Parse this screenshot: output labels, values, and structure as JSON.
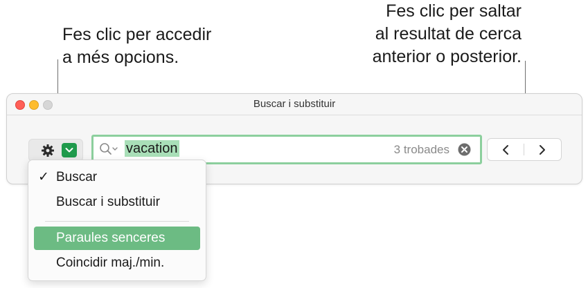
{
  "callouts": {
    "options_line1": "Fes clic per accedir",
    "options_line2": "a més opcions.",
    "nav_line1": "Fes clic per saltar",
    "nav_line2": "al resultat de cerca",
    "nav_line3": "anterior o posterior."
  },
  "window": {
    "title": "Buscar i substituir"
  },
  "search": {
    "query": "vacation",
    "match_count": "3 trobades"
  },
  "menu": {
    "items": [
      {
        "label": "Buscar",
        "checked": true
      },
      {
        "label": "Buscar i substituir",
        "checked": false
      },
      {
        "label": "Paraules senceres",
        "highlighted": true
      },
      {
        "label": "Coincidir maj./min.",
        "checked": false
      }
    ],
    "check_mark": "✓"
  },
  "icons": {
    "gear": "gear-icon",
    "options_chevron": "chevron-down-icon",
    "search": "magnifier-icon",
    "clear": "clear-icon",
    "prev": "chevron-left-icon",
    "next": "chevron-right-icon"
  },
  "colors": {
    "accent": "#1f9a4c",
    "field_focus": "#8ccf9d",
    "selection": "#a9dfb8",
    "menu_highlight": "#6cbb83"
  }
}
